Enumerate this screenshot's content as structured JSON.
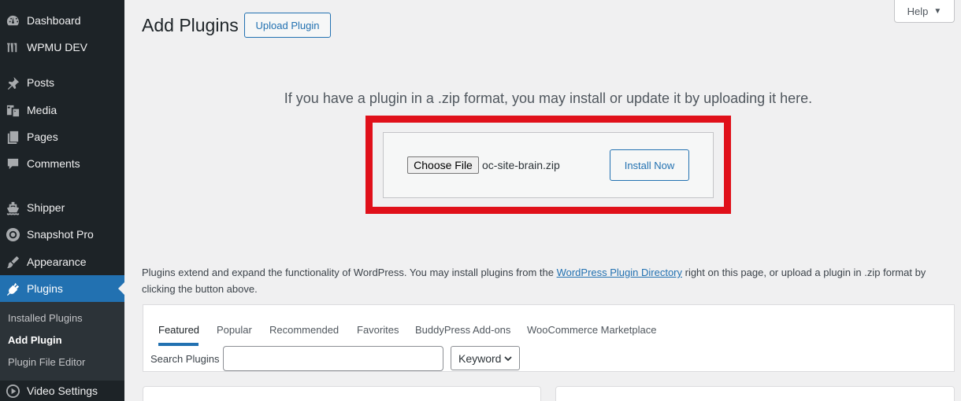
{
  "sidebar": {
    "items": [
      {
        "label": "Dashboard",
        "icon": "dashboard-icon"
      },
      {
        "label": "WPMU DEV",
        "icon": "wpmudev-icon"
      },
      {
        "label": "Posts",
        "icon": "pin-icon"
      },
      {
        "label": "Media",
        "icon": "media-icon"
      },
      {
        "label": "Pages",
        "icon": "pages-icon"
      },
      {
        "label": "Comments",
        "icon": "comments-icon"
      },
      {
        "label": "Shipper",
        "icon": "ship-icon"
      },
      {
        "label": "Snapshot Pro",
        "icon": "snapshot-icon"
      },
      {
        "label": "Appearance",
        "icon": "brush-icon"
      },
      {
        "label": "Plugins",
        "icon": "plugin-icon"
      },
      {
        "label": "Video Settings",
        "icon": "play-icon"
      }
    ],
    "submenu": [
      {
        "label": "Installed Plugins"
      },
      {
        "label": "Add Plugin"
      },
      {
        "label": "Plugin File Editor"
      }
    ],
    "active_color": "#2271b1"
  },
  "header": {
    "title": "Add Plugins",
    "upload_button": "Upload Plugin",
    "help_button": "Help"
  },
  "upload": {
    "instructions": "If you have a plugin in a .zip format, you may install or update it by uploading it here.",
    "choose_file_label": "Choose File",
    "file_name": "oc-site-brain.zip",
    "install_button": "Install Now",
    "highlight_color": "#e0101a"
  },
  "description": {
    "before_link": "Plugins extend and expand the functionality of WordPress. You may install plugins from the ",
    "link_text": "WordPress Plugin Directory",
    "after_link": " right on this page, or upload a plugin in .zip format by clicking the button above."
  },
  "filter": {
    "tabs": [
      {
        "label": "Featured"
      },
      {
        "label": "Popular"
      },
      {
        "label": "Recommended"
      },
      {
        "label": "Favorites"
      },
      {
        "label": "BuddyPress Add-ons"
      },
      {
        "label": "WooCommerce Marketplace"
      }
    ],
    "search_label": "Search Plugins",
    "search_value": "",
    "search_type": "Keyword"
  }
}
